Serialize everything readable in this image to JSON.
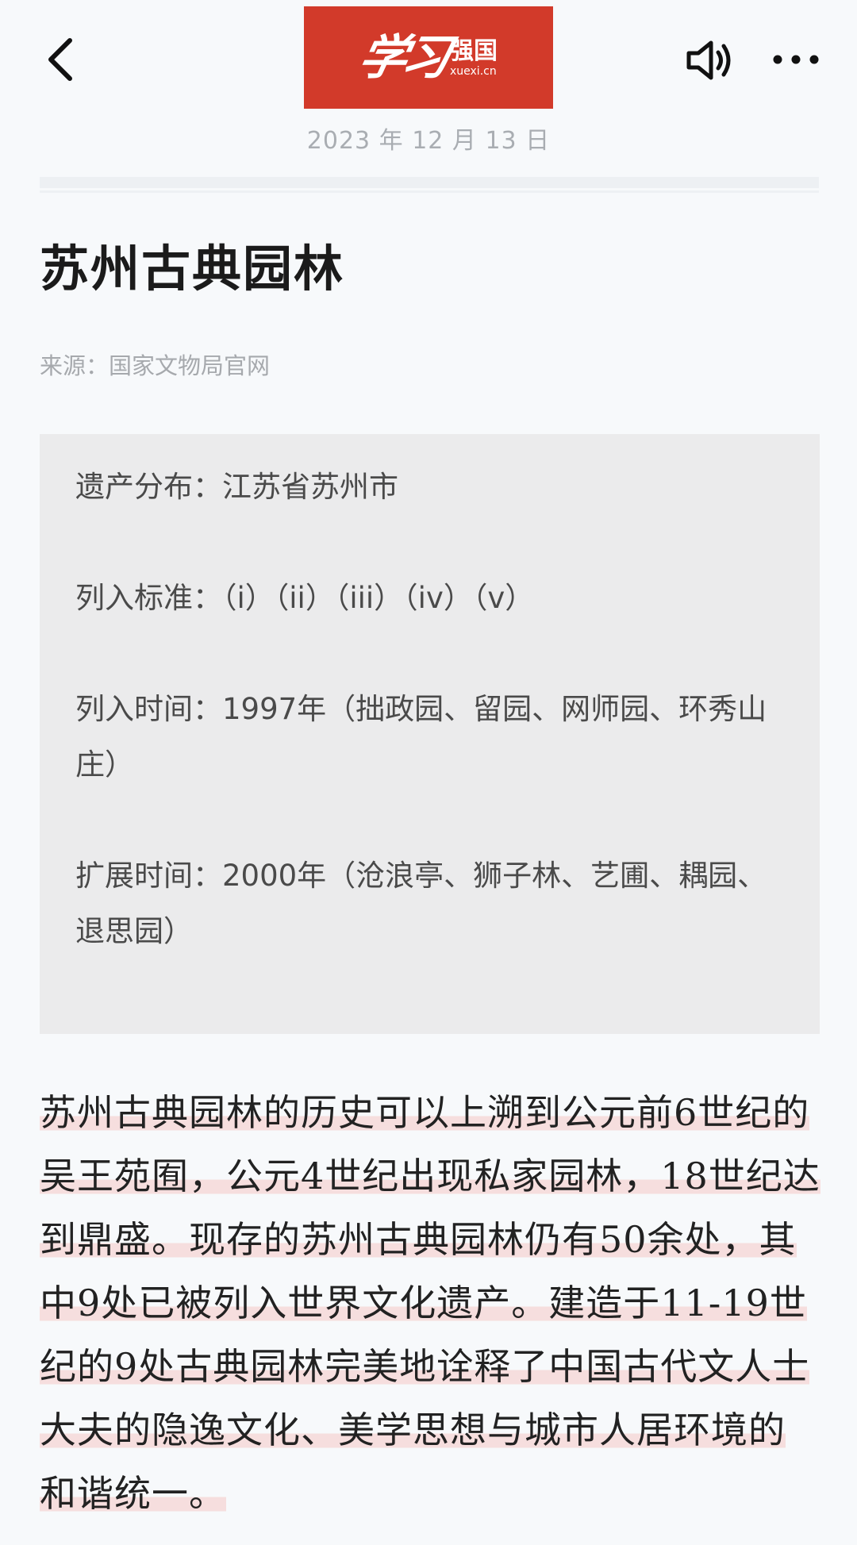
{
  "header": {
    "logo_script": "学习",
    "logo_name": "强国",
    "logo_url": "xuexi.cn",
    "date": "2023 年 12 月 13 日",
    "icons": {
      "back": "chevron-left-icon",
      "speaker": "speaker-icon",
      "more": "more-dots-icon"
    }
  },
  "article": {
    "title": "苏州古典园林",
    "source": "来源：国家文物局官网",
    "info": {
      "distribution": "遗产分布：江苏省苏州市",
      "criteria": "列入标准：（i）（ii）（iii）（iv）（v）",
      "inscribed": "列入时间：1997年（拙政园、留园、网师园、环秀山庄）",
      "extension": "扩展时间：2000年（沧浪亭、狮子林、艺圃、耦园、退思园）"
    },
    "body": "苏州古典园林的历史可以上溯到公元前6世纪的吴王苑囿，公元4世纪出现私家园林，18世纪达到鼎盛。现存的苏州古典园林仍有50余处，其中9处已被列入世界文化遗产。建造于11-19世纪的9处古典园林完美地诠释了中国古代文人士大夫的隐逸文化、美学思想与城市人居环境的和谐统一。"
  },
  "colors": {
    "logo_red": "#d23a2a",
    "highlight": "#f6dede",
    "info_bg": "#ebebec"
  }
}
